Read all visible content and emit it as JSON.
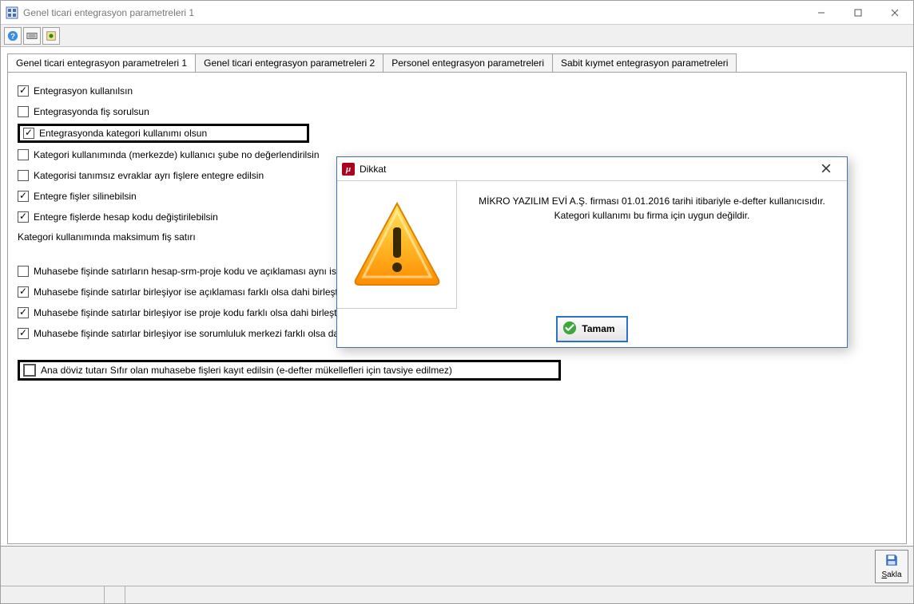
{
  "window": {
    "title": "Genel ticari entegrasyon parametreleri 1"
  },
  "tabs": [
    {
      "label": "Genel ticari entegrasyon parametreleri 1"
    },
    {
      "label": "Genel ticari entegrasyon parametreleri 2"
    },
    {
      "label": "Personel entegrasyon parametreleri"
    },
    {
      "label": "Sabit kıymet entegrasyon parametreleri"
    }
  ],
  "options": {
    "o1": "Entegrasyon kullanılsın",
    "o2": "Entegrasyonda fiş sorulsun",
    "o3": "Entegrasyonda kategori kullanımı olsun",
    "o4": "Kategori kullanımında (merkezde) kullanıcı şube no değerlendirilsin",
    "o5": "Kategorisi tanımsız evraklar ayrı fişlere entegre edilsin",
    "o6": "Entegre fişler silinebilsin",
    "o7": "Entegre fişlerde hesap kodu değiştirilebilsin",
    "o8_label": "Kategori kullanımında maksimum fiş satırı",
    "o9": "Muhasebe fişinde satırların hesap-srm-proje kodu ve açıklaması aynı ise birleştir",
    "o10": "Muhasebe fişinde satırlar birleşiyor ise açıklaması farklı olsa dahi birleştir",
    "o11": "Muhasebe fişinde satırlar birleşiyor ise proje kodu farklı olsa dahi birleştir",
    "o12": "Muhasebe fişinde satırlar birleşiyor ise sorumluluk merkezi farklı olsa dahi birleştir",
    "o13": "Ana döviz tutarı Sıfır olan muhasebe fişleri kayıt edilsin (e-defter mükellefleri için tavsiye edilmez)"
  },
  "dialog": {
    "title": "Dikkat",
    "message": "MİKRO YAZILIM EVİ A.Ş. firması 01.01.2016 tarihi itibariyle e-defter kullanıcısıdır. Kategori kullanımı bu firma için uygun değildir.",
    "ok_label": "Tamam"
  },
  "footer": {
    "save_label": "Sakla"
  }
}
